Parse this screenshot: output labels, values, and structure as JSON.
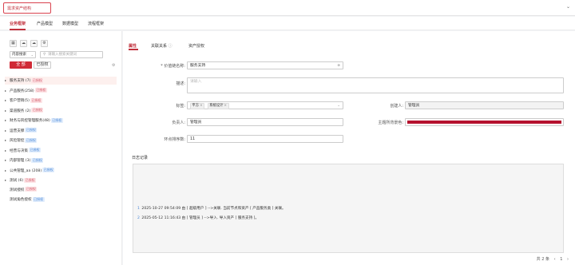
{
  "header": {
    "title": "需求资产结构"
  },
  "tabs": [
    "业务框架",
    "产品模型",
    "数据模型",
    "流程框架"
  ],
  "left": {
    "toolbar": [
      "grid-icon",
      "cloud-upload-icon",
      "cloud-download-icon",
      "settings-icon"
    ],
    "scope_select": "内容搜索",
    "search_placeholder": "请输入搜索关键词",
    "btn_all": "全 部",
    "btn_authorized": "已授权",
    "tree": [
      {
        "arrow": "▸",
        "label": "服务支持 (7)",
        "badge": "已授权",
        "badge_color": "pink",
        "selected": true
      },
      {
        "arrow": "▸",
        "label": "产品服务(258)",
        "badge": "已授权",
        "badge_color": "pink"
      },
      {
        "arrow": "▸",
        "label": "客户营销(5)",
        "badge": "已授权",
        "badge_color": "pink"
      },
      {
        "arrow": "▸",
        "label": "渠道服务 (2)",
        "badge": "已授权",
        "badge_color": "pink"
      },
      {
        "arrow": "▸",
        "label": "财务与风控管理服务(48)",
        "badge": "已授权",
        "badge_color": "blue"
      },
      {
        "arrow": "▸",
        "label": "运营支撑",
        "badge": "已授权",
        "badge_color": "blue"
      },
      {
        "arrow": "▸",
        "label": "风险管控",
        "badge": "已授权",
        "badge_color": "blue"
      },
      {
        "arrow": "▸",
        "label": "经营与决策",
        "badge": "已授权",
        "badge_color": "blue"
      },
      {
        "arrow": "▸",
        "label": "内部管理 (3)",
        "badge": "已授权",
        "badge_color": "blue"
      },
      {
        "arrow": "▸",
        "label": "公共管理_aa (208)",
        "badge": "已授权",
        "badge_color": "blue"
      },
      {
        "arrow": "▸",
        "label": "测试 (6)",
        "badge": "已授权",
        "badge_color": "pink"
      },
      {
        "arrow": "",
        "label": "测试授权",
        "badge": "已授权",
        "badge_color": "pink"
      },
      {
        "arrow": "",
        "label": "测试角色授权",
        "badge": "已授权",
        "badge_color": "blue"
      }
    ]
  },
  "right": {
    "tabs": [
      "属性",
      "关联关系",
      "资产授权"
    ],
    "form": {
      "chain_label": "* 价值链名称:",
      "chain_value": "服务支持",
      "desc_label": "描述:",
      "desc_placeholder": "请输入",
      "tags_label": "标签:",
      "tags": [
        "平方",
        "系统设计"
      ],
      "creator_label": "创建人:",
      "creator_value": "管理员",
      "owner_label": "负责人:",
      "owner_value": "管理员",
      "bg_label": "主题所背景色:",
      "bg_color": "#b5122e",
      "sort_label": "环点排序数:",
      "sort_value": "11"
    },
    "log": {
      "title": "日志记录",
      "lines": [
        {
          "n": "1",
          "text": "2025-10-27 09:54:09   由 [ 超级用户 ] -->关联. 当前节点和资产 [ 产品服务类 ] 关联。"
        },
        {
          "n": "2",
          "text": "2025-05-12 11:16:43   由 [ 管理员 ] -->导入. 导入资产 [ 服务支持 ]。"
        }
      ]
    },
    "pager": {
      "total": "共 2 条",
      "page": "1"
    }
  }
}
